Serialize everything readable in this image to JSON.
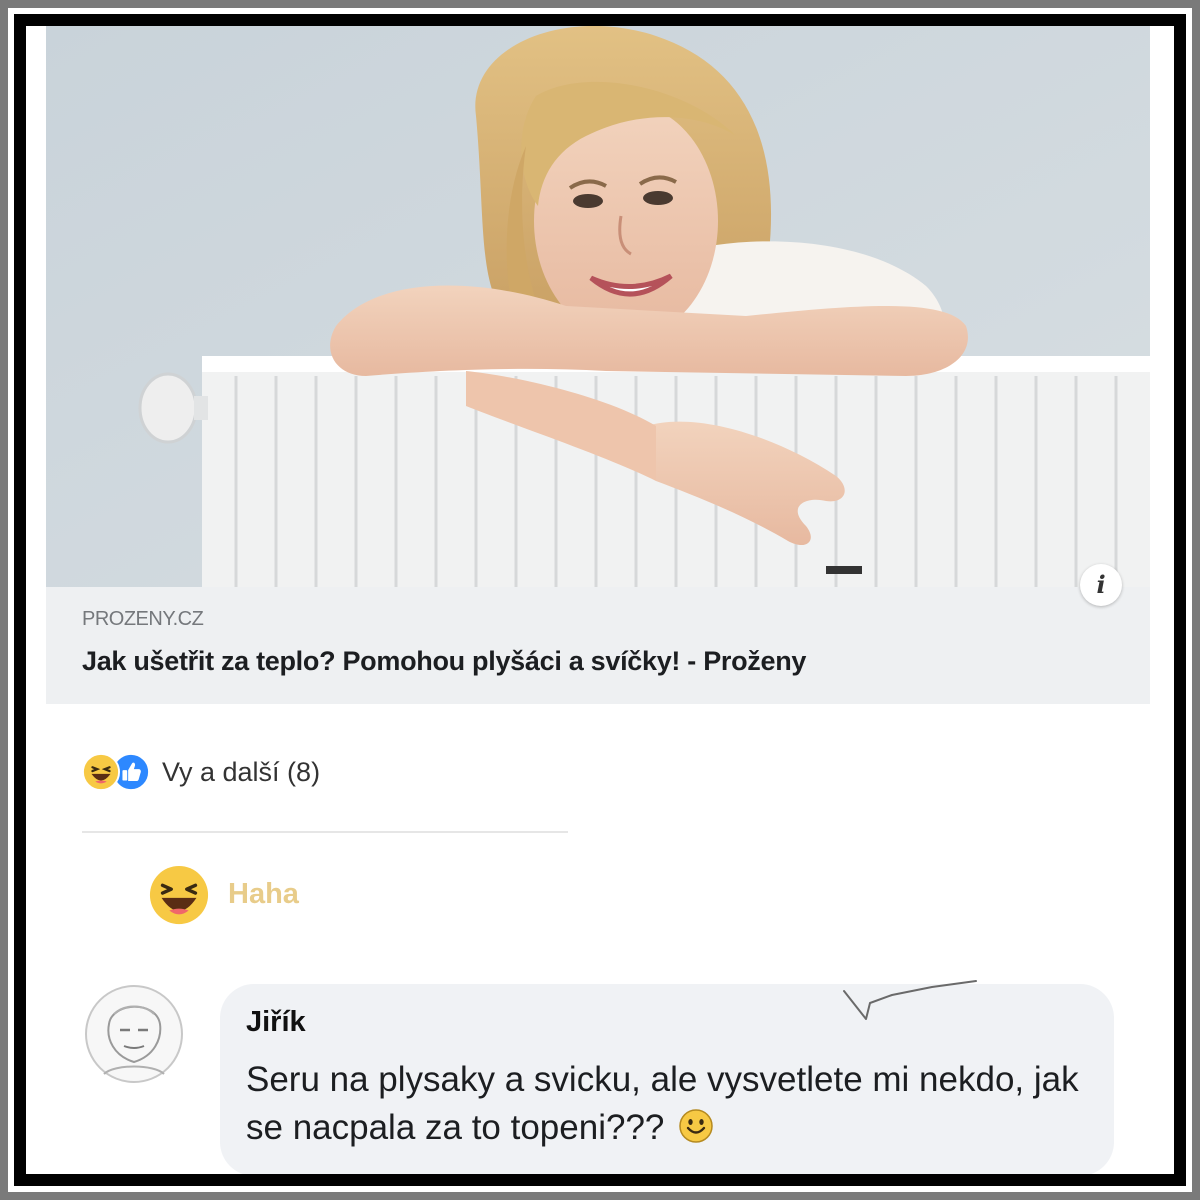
{
  "link_preview": {
    "domain": "PROZENY.CZ",
    "title": "Jak ušetřit za teplo? Pomohou plyšáci a svíčky! - Proženy",
    "info_icon_glyph": "i"
  },
  "reactions_summary": {
    "icons": [
      "haha-emoji-icon",
      "like-icon"
    ],
    "text": "Vy a další (8)"
  },
  "user_reaction": {
    "icon": "haha-emoji-icon",
    "label": "Haha",
    "color": "#e8cc8a"
  },
  "comment": {
    "author": "Jiřík",
    "text": "Seru na plysaky a svicku, ale vysvetlete mi nekdo, jak se nacpala za to topeni???",
    "trailing_icon": "smiley-emoji-icon"
  },
  "colors": {
    "frame": "#000000",
    "card_background": "#eef0f2",
    "bubble_background": "#f0f2f5",
    "like_blue": "#2d88ff",
    "emoji_yellow": "#f7c944"
  }
}
